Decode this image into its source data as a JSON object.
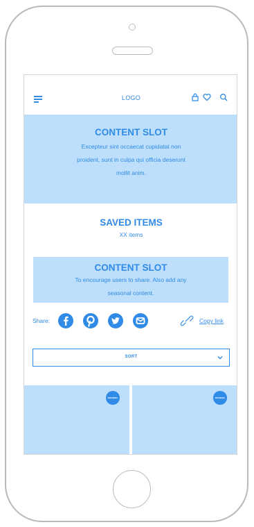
{
  "header": {
    "logo": "LOGO",
    "icons": [
      "menu-icon",
      "bag-icon",
      "heart-icon",
      "search-icon"
    ]
  },
  "content_slot_top": {
    "title": "CONTENT SLOT",
    "lines": [
      "Excepteur sint occaecat cupidatat non",
      "proident, sunt in culpa qui officia deserunt",
      "mollit anim."
    ]
  },
  "saved": {
    "title": "SAVED ITEMS",
    "count": "XX items"
  },
  "content_slot_share": {
    "title": "CONTENT SLOT",
    "lines": [
      "To encourage users to share. Also add any",
      "seasonal content."
    ]
  },
  "share": {
    "label": "Share:",
    "icons": [
      "facebook-icon",
      "pinterest-icon",
      "twitter-icon",
      "email-icon"
    ],
    "copy_link": "Copy link"
  },
  "sort": {
    "label": "SORT"
  },
  "products": [
    {
      "badge": "ROUNDEL"
    },
    {
      "badge": "ROUNDEL"
    }
  ],
  "colors": {
    "accent": "#2f8be6",
    "slot_background": "#bedffb",
    "frame": "#b9b9b9"
  }
}
